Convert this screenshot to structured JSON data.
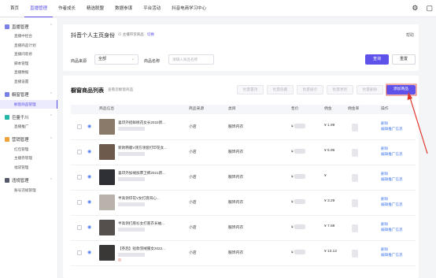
{
  "topnav": {
    "items": [
      "首页",
      "直播管理",
      "作者成长",
      "精选联盟",
      "数据参谋",
      "平台活动",
      "抖音电商学习中心"
    ],
    "active_index": 1
  },
  "top_icons": [
    "settings-icon",
    "message-icon"
  ],
  "sidebar": {
    "groups": [
      {
        "label": "直播管理",
        "icon": "live-icon",
        "color": "#7b7fe8",
        "items": [
          "直播中控台",
          "直播商品计划",
          "直播间装修",
          "脚本管理",
          "直播数据",
          "直播设置"
        ]
      },
      {
        "label": "橱窗管理",
        "icon": "showcase-icon",
        "color": "#7b7fe8",
        "items": [
          "橱窗商品管理"
        ],
        "active_item": 0
      },
      {
        "label": "巨量千川",
        "icon": "qianchuan-icon",
        "color": "#23b5a6",
        "items": [
          "直播推广"
        ]
      },
      {
        "label": "营销管理",
        "icon": "marketing-icon",
        "color": "#f0a23a",
        "items": [
          "红包管理",
          "主播券管理",
          "福袋管理"
        ]
      },
      {
        "label": "违规管理",
        "icon": "violation-icon",
        "color": "#555a6b",
        "items": [
          "账号违规管理"
        ]
      }
    ]
  },
  "shop": {
    "title": "抖音个人主页身份",
    "tag": "主播带货商品",
    "switch": "切换",
    "help": "帮助"
  },
  "filters": {
    "source_label": "商品来源",
    "source_value": "全部",
    "name_label": "商品名称",
    "name_placeholder": "请输入商品名称",
    "search_button": "查询",
    "reset_button": "重置"
  },
  "list": {
    "title": "橱窗商品列表",
    "subtitle": "查看您橱窗商品",
    "actions": [
      "批量置顶",
      "批量隐藏",
      "批量展示",
      "批量更新",
      "批量删除"
    ],
    "add_button": "添加商品",
    "columns": [
      "商品信息",
      "商品来源",
      "类目",
      "售价",
      "佣金",
      "佣金率",
      "操作"
    ]
  },
  "rows": [
    {
      "name": "喜印外搭鲜桃花女长2022新...",
      "source": "小店",
      "category": "服饰内衣",
      "price": "¥",
      "commission": "¥ 1.99",
      "rate": "",
      "ops": [
        "删除",
        "编辑推广信息"
      ],
      "thumb": "#8a7a6a"
    },
    {
      "name": "新款韩版V领方领套打印花女...",
      "source": "小店",
      "category": "服饰内衣",
      "price": "¥",
      "commission": "¥ 5.96",
      "rate": "",
      "ops": [
        "删除",
        "编辑推广信息"
      ],
      "thumb": "#6e5a4c"
    },
    {
      "name": "喜印外加绒加厚卫裤2021新...",
      "source": "小店",
      "category": "服饰内衣",
      "price": "¥",
      "commission": "¥",
      "rate": "",
      "ops": [
        "删除",
        "编辑推广信息"
      ],
      "thumb": "#2f2f36"
    },
    {
      "name": "半高领印花V女打底背心...",
      "source": "小店",
      "category": "服饰内衣",
      "price": "¥",
      "commission": "¥ 3.29",
      "rate": "",
      "ops": [
        "删除",
        "编辑推广信息"
      ],
      "thumb": "#b9b2ab"
    },
    {
      "name": "半高领打底衫女打底衣长袖...",
      "source": "小店",
      "category": "服饰内衣",
      "price": "¥",
      "commission": "¥ 7.98",
      "rate": "",
      "ops": [
        "删除",
        "编辑推广信息"
      ],
      "thumb": "#55504e"
    },
    {
      "name": "【券后】短款羽绒服女2022...",
      "source": "小店",
      "category": "服饰内衣",
      "price": "¥",
      "commission": "¥ 13.12",
      "rate": "",
      "ops": [
        "删除",
        "编辑推广信息"
      ],
      "thumb": "#3a3837"
    }
  ]
}
